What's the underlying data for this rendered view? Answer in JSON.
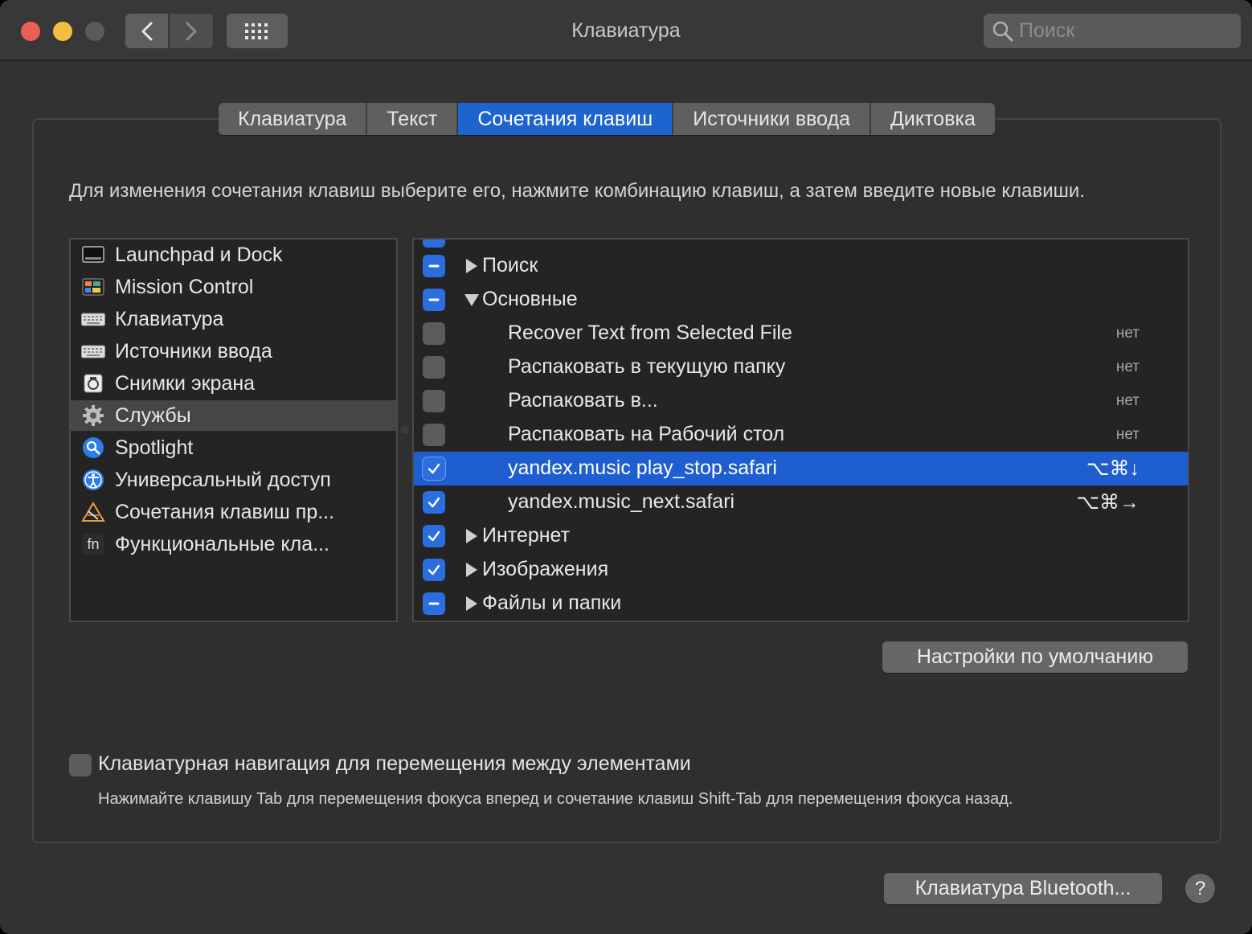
{
  "window": {
    "title": "Клавиатура"
  },
  "search": {
    "placeholder": "Поиск"
  },
  "tabs": [
    {
      "label": "Клавиатура",
      "active": false
    },
    {
      "label": "Текст",
      "active": false
    },
    {
      "label": "Сочетания клавиш",
      "active": true
    },
    {
      "label": "Источники ввода",
      "active": false
    },
    {
      "label": "Диктовка",
      "active": false
    }
  ],
  "instruction": "Для изменения сочетания клавиш выберите его, нажмите комбинацию клавиш, а затем введите новые клавиши.",
  "categories": [
    {
      "label": "Launchpad и Dock",
      "icon": "launchpad-icon"
    },
    {
      "label": "Mission Control",
      "icon": "mission-control-icon"
    },
    {
      "label": "Клавиатура",
      "icon": "keyboard-icon"
    },
    {
      "label": "Источники ввода",
      "icon": "keyboard-icon"
    },
    {
      "label": "Снимки экрана",
      "icon": "screenshot-icon"
    },
    {
      "label": "Службы",
      "icon": "gear-icon",
      "selected": true
    },
    {
      "label": "Spotlight",
      "icon": "spotlight-icon"
    },
    {
      "label": "Универсальный доступ",
      "icon": "accessibility-icon"
    },
    {
      "label": "Сочетания клавиш пр...",
      "icon": "app-shortcuts-icon"
    },
    {
      "label": "Функциональные кла...",
      "icon": "fn-icon"
    }
  ],
  "shortcuts": [
    {
      "label": "Поиск",
      "type": "group",
      "expanded": false,
      "state": "mixed"
    },
    {
      "label": "Основные",
      "type": "group",
      "expanded": true,
      "state": "mixed"
    },
    {
      "label": "Recover Text from Selected File",
      "type": "leaf",
      "state": "off",
      "shortcut": "нет"
    },
    {
      "label": "Распаковать в текущую папку",
      "type": "leaf",
      "state": "off",
      "shortcut": "нет"
    },
    {
      "label": "Распаковать в...",
      "type": "leaf",
      "state": "off",
      "shortcut": "нет"
    },
    {
      "label": "Распаковать на Рабочий стол",
      "type": "leaf",
      "state": "off",
      "shortcut": "нет"
    },
    {
      "label": "yandex.music play_stop.safari",
      "type": "leaf",
      "state": "on",
      "shortcut": "⌥⌘↓",
      "selected": true
    },
    {
      "label": "yandex.music_next.safari",
      "type": "leaf",
      "state": "on",
      "shortcut": "⌥⌘→"
    },
    {
      "label": "Интернет",
      "type": "group",
      "expanded": false,
      "state": "on"
    },
    {
      "label": "Изображения",
      "type": "group",
      "expanded": false,
      "state": "on"
    },
    {
      "label": "Файлы и папки",
      "type": "group",
      "expanded": false,
      "state": "mixed"
    }
  ],
  "buttons": {
    "defaults": "Настройки по умолчанию",
    "bluetooth": "Клавиатура Bluetooth...",
    "help": "?"
  },
  "keyboard_nav": {
    "label": "Клавиатурная навигация для перемещения между элементами",
    "hint": "Нажимайте клавишу Tab для перемещения фокуса вперед и сочетание клавиш Shift-Tab для перемещения фокуса назад.",
    "checked": false
  },
  "colors": {
    "accent": "#1e64d0",
    "selection": "#1e5ed0"
  }
}
